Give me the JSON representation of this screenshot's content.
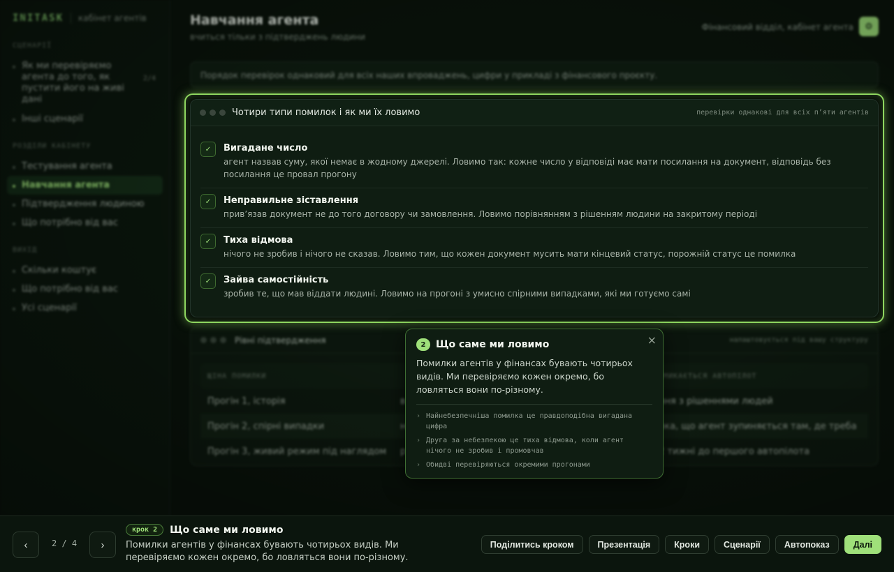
{
  "sidebar": {
    "brand": "INITASK",
    "brand_sub": "кабінет агентів",
    "sections": [
      {
        "title": "СЦЕНАРІЇ"
      },
      {
        "title": "РОЗДІЛИ КАБІНЕТУ"
      },
      {
        "title": "ВИХІД"
      }
    ],
    "scenarios": [
      {
        "label": "Як ми перевіряємо агента до того, як пустити його на живі дані",
        "count": "2/4"
      },
      {
        "label": "Інші сценарії"
      }
    ],
    "sections_items": [
      {
        "label": "Тестування агента"
      },
      {
        "label": "Навчання агента"
      },
      {
        "label": "Підтвердження людиною"
      },
      {
        "label": "Що потрібно від вас"
      }
    ],
    "exit_items": [
      {
        "label": "Скільки коштує"
      },
      {
        "label": "Що потрібно від вас"
      },
      {
        "label": "Усі сценарії"
      }
    ]
  },
  "header": {
    "title": "Навчання агента",
    "subtitle": "вчиться тільки з підтверджень людини",
    "context": "Фінансовий відділ, кабінет агента"
  },
  "notice": "Порядок перевірок однаковий для всіх наших впроваджень, цифри у прикладі з фінансового проєкту.",
  "focus_card": {
    "title": "Чотири типи помилок і як ми їх ловимо",
    "meta": "перевірки однакові для всіх п’яти агентів",
    "check_glyph": "✓",
    "errors": [
      {
        "title": "Вигадане число",
        "desc": "агент назвав суму, якої немає в жодному джерелі. Ловимо так: кожне число у відповіді має мати посилання на документ, відповідь без посилання це провал прогону"
      },
      {
        "title": "Неправильне зіставлення",
        "desc": "прив’язав документ не до того договору чи замовлення. Ловимо порівнянням з рішенням людини на закритому періоді"
      },
      {
        "title": "Тиха відмова",
        "desc": "нічого не зробив і нічого не сказав. Ловимо тим, що кожен документ мусить мати кінцевий статус, порожній статус це помилка"
      },
      {
        "title": "Зайва самостійність",
        "desc": "зробив те, що мав віддати людині. Ловимо на прогоні з умисно спірними випадками, які ми готуємо самі"
      }
    ]
  },
  "levels_card": {
    "title": "Рівні підтвердження",
    "meta": "налаштовується під вашу структуру",
    "columns": [
      "ЩІНА ПОМИЛКИ",
      "",
      "ВМИКАЄТЬСЯ АВТОПІЛОТ"
    ],
    "rows": [
      [
        "Прогін 1, історія",
        "в",
        "ння з рішеннями людей"
      ],
      [
        "Прогін 2, спірні випадки",
        "н",
        "рка, що агент зупиняється там, де треба"
      ],
      [
        "Прогін 3, живий режим під наглядом",
        "р",
        "2 тижні до першого автопілота"
      ]
    ]
  },
  "popover": {
    "number": "2",
    "title": "Що саме ми ловимо",
    "body": "Помилки агентів у фінансах бувають чотирьох видів. Ми перевіряємо кожен окремо, бо ловляться вони по-різному.",
    "bullets": [
      "Найнебезпечніша помилка це правдоподібна вигадана цифра",
      "Друга за небезпекою це тиха відмова, коли агент нічого не зробив і промовчав",
      "Обидві перевіряються окремими прогонами"
    ],
    "close_glyph": "×",
    "bullet_glyph": "›"
  },
  "bottom": {
    "prev_glyph": "‹",
    "next_glyph": "›",
    "counter": "2 / 4",
    "badge": "крок 2",
    "title": "Що саме ми ловимо",
    "desc": "Помилки агентів у фінансах бувають чотирьох видів. Ми перевіряємо кожен окремо, бо ловляться вони по-різному.",
    "actions": {
      "share": "Поділитись кроком",
      "presentation": "Презентація",
      "steps": "Кроки",
      "scenarios": "Сценарії",
      "autoplay": "Автопоказ",
      "next": "Далі"
    }
  },
  "colors": {
    "accent": "#9fe07a",
    "focus_ring": "#8ed65f",
    "background": "#081009"
  }
}
